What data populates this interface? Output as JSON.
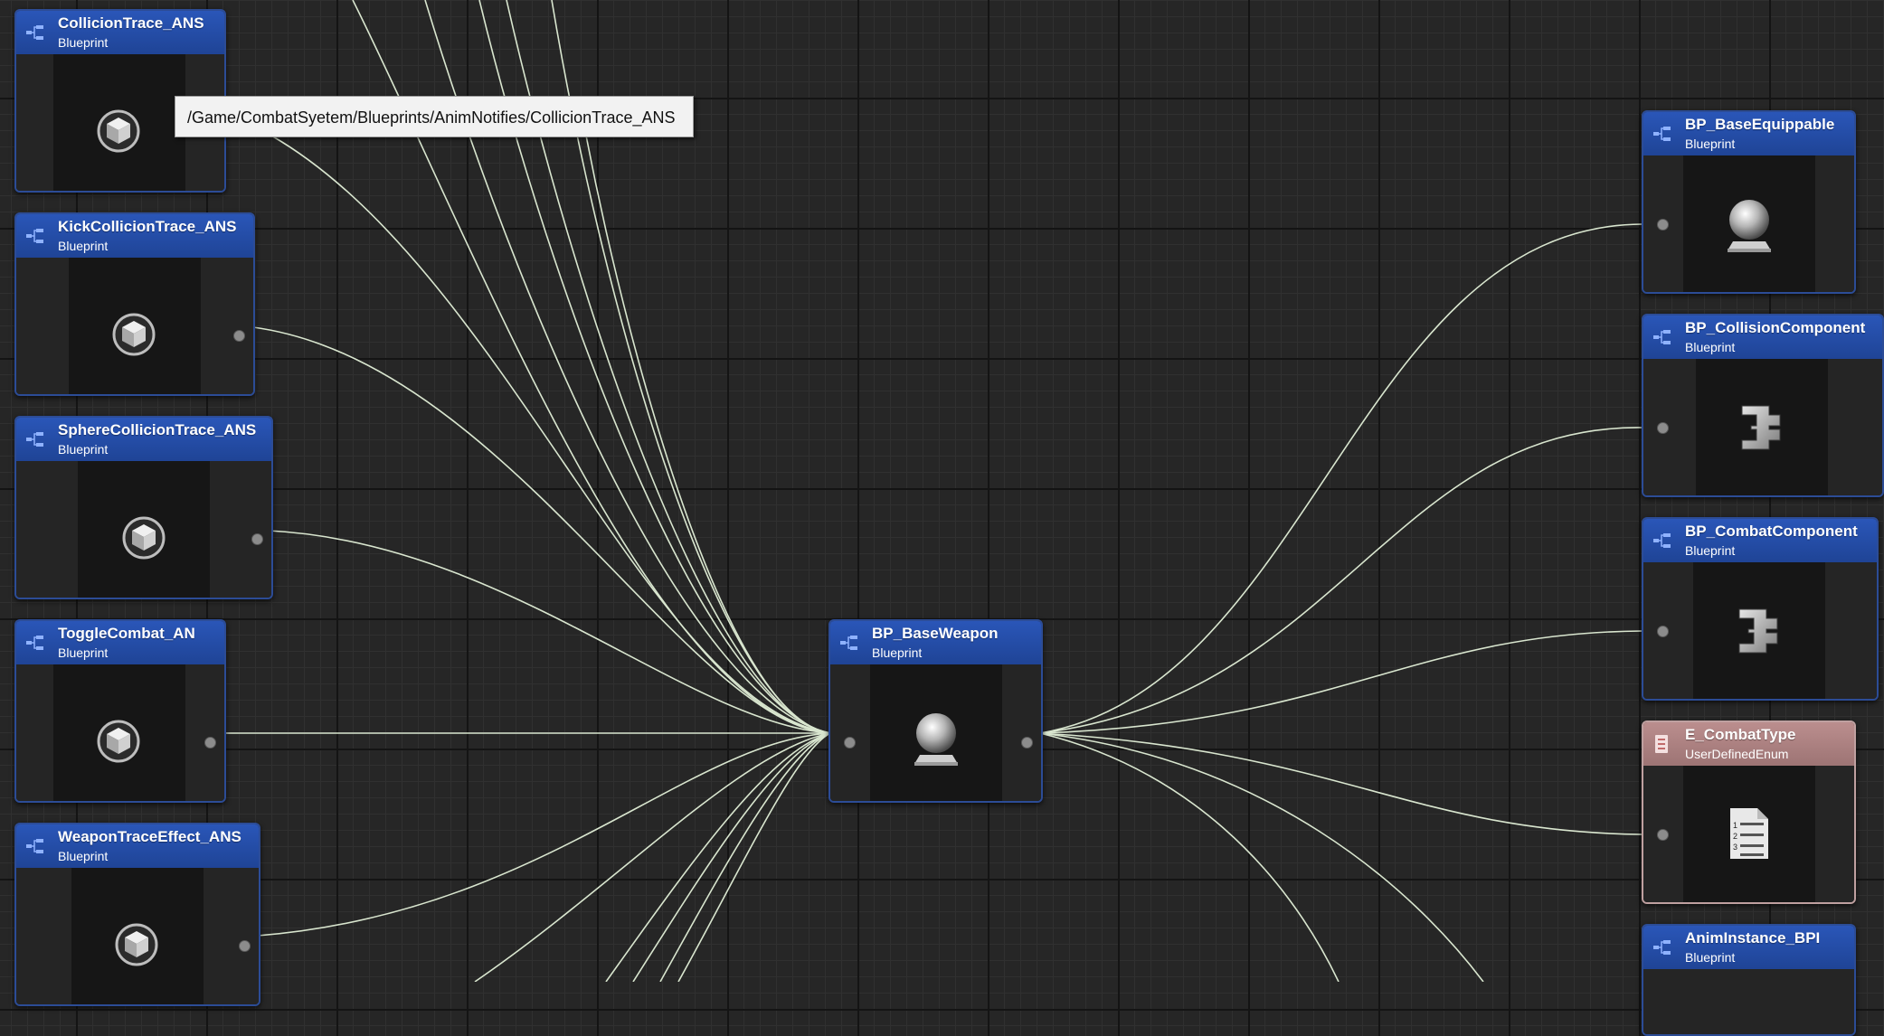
{
  "tooltip": "/Game/CombatSyetem/Blueprints/AnimNotifies/CollicionTrace_ANS",
  "nodes": [
    {
      "title": "CollicionTrace_ANS",
      "type": "Blueprint",
      "icon": "cube-icon"
    },
    {
      "title": "KickCollicionTrace_ANS",
      "type": "Blueprint",
      "icon": "cube-icon"
    },
    {
      "title": "SphereCollicionTrace_ANS",
      "type": "Blueprint",
      "icon": "cube-icon"
    },
    {
      "title": "ToggleCombat_AN",
      "type": "Blueprint",
      "icon": "cube-icon"
    },
    {
      "title": "WeaponTraceEffect_ANS",
      "type": "Blueprint",
      "icon": "cube-icon"
    },
    {
      "title": "BP_BaseWeapon",
      "type": "Blueprint",
      "icon": "actor-sphere-icon"
    },
    {
      "title": "BP_BaseEquippable",
      "type": "Blueprint",
      "icon": "actor-sphere-icon"
    },
    {
      "title": "BP_CollisionComponent",
      "type": "Blueprint",
      "icon": "component-icon"
    },
    {
      "title": "BP_CombatComponent",
      "type": "Blueprint",
      "icon": "component-icon"
    },
    {
      "title": "E_CombatType",
      "type": "UserDefinedEnum",
      "icon": "enum-list-icon"
    },
    {
      "title": "AnimInstance_BPI",
      "type": "Blueprint",
      "icon": "interface-icon"
    }
  ],
  "colors": {
    "blueprint_header": "#2a56b8",
    "enum_header": "#bb8e8e",
    "wire": "#d9e6cf",
    "canvas": "#262626"
  }
}
